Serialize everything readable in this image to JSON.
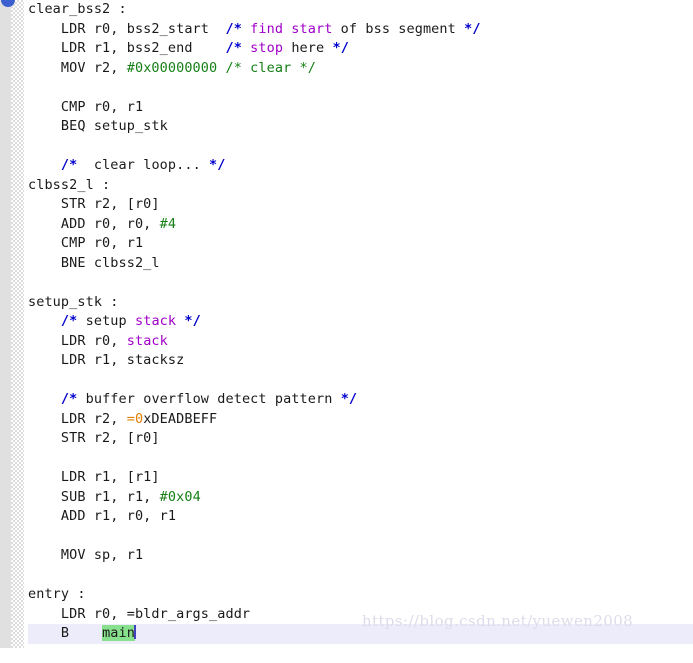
{
  "editor": {
    "title": "assembly-source-view",
    "language": "arm-assembly",
    "colors": {
      "background": "#ffffff",
      "gutter": "#e0e0e0",
      "current_line": "#ececfa",
      "selection": "#87e08c",
      "caret": "#4040c0",
      "default_text": "#1a1a1a",
      "comment_delimiter": "#0000cc",
      "comment_keyword": "#a000c8",
      "comment_green": "#178017",
      "number": "#178017",
      "orange_literal": "#e08000",
      "purple_symbol": "#a000c8",
      "watermark": "#dcdcea"
    }
  },
  "watermark": {
    "text": "https://blog.csdn.net/yuewen2008"
  },
  "code": {
    "lines": [
      {
        "id": 1,
        "current": false,
        "tokens": [
          {
            "t": "clear_bss2 :",
            "c": "default"
          }
        ]
      },
      {
        "id": 2,
        "current": false,
        "tokens": [
          {
            "t": "    LDR r0, bss2_start  ",
            "c": "default"
          },
          {
            "t": "/*",
            "c": "comment-delim"
          },
          {
            "t": " ",
            "c": "default"
          },
          {
            "t": "find start",
            "c": "comment-kw"
          },
          {
            "t": " of bss segment ",
            "c": "default"
          },
          {
            "t": "*/",
            "c": "comment-delim"
          }
        ]
      },
      {
        "id": 3,
        "current": false,
        "tokens": [
          {
            "t": "    LDR r1, bss2_end    ",
            "c": "default"
          },
          {
            "t": "/*",
            "c": "comment-delim"
          },
          {
            "t": " ",
            "c": "default"
          },
          {
            "t": "stop",
            "c": "comment-kw"
          },
          {
            "t": " here ",
            "c": "default"
          },
          {
            "t": "*/",
            "c": "comment-delim"
          }
        ]
      },
      {
        "id": 4,
        "current": false,
        "tokens": [
          {
            "t": "    MOV r2, ",
            "c": "default"
          },
          {
            "t": "#0x00000000",
            "c": "number"
          },
          {
            "t": " ",
            "c": "default"
          },
          {
            "t": "/* clear */",
            "c": "comment-green"
          }
        ]
      },
      {
        "id": 5,
        "current": false,
        "tokens": [
          {
            "t": "",
            "c": "default"
          }
        ]
      },
      {
        "id": 6,
        "current": false,
        "tokens": [
          {
            "t": "    CMP r0, r1",
            "c": "default"
          }
        ]
      },
      {
        "id": 7,
        "current": false,
        "tokens": [
          {
            "t": "    BEQ setup_stk",
            "c": "default"
          }
        ]
      },
      {
        "id": 8,
        "current": false,
        "tokens": [
          {
            "t": "",
            "c": "default"
          }
        ]
      },
      {
        "id": 9,
        "current": false,
        "tokens": [
          {
            "t": "    ",
            "c": "default"
          },
          {
            "t": "/*",
            "c": "comment-delim"
          },
          {
            "t": "  clear loop... ",
            "c": "default"
          },
          {
            "t": "*/",
            "c": "comment-delim"
          }
        ]
      },
      {
        "id": 10,
        "current": false,
        "tokens": [
          {
            "t": "clbss2_l :",
            "c": "default"
          }
        ]
      },
      {
        "id": 11,
        "current": false,
        "tokens": [
          {
            "t": "    STR r2, [r0]",
            "c": "default"
          }
        ]
      },
      {
        "id": 12,
        "current": false,
        "tokens": [
          {
            "t": "    ADD r0, r0, ",
            "c": "default"
          },
          {
            "t": "#4",
            "c": "number"
          }
        ]
      },
      {
        "id": 13,
        "current": false,
        "tokens": [
          {
            "t": "    CMP r0, r1",
            "c": "default"
          }
        ]
      },
      {
        "id": 14,
        "current": false,
        "tokens": [
          {
            "t": "    BNE clbss2_l",
            "c": "default"
          }
        ]
      },
      {
        "id": 15,
        "current": false,
        "tokens": [
          {
            "t": "",
            "c": "default"
          }
        ]
      },
      {
        "id": 16,
        "current": false,
        "tokens": [
          {
            "t": "setup_stk :",
            "c": "default"
          }
        ]
      },
      {
        "id": 17,
        "current": false,
        "tokens": [
          {
            "t": "    ",
            "c": "default"
          },
          {
            "t": "/*",
            "c": "comment-delim"
          },
          {
            "t": " setup ",
            "c": "default"
          },
          {
            "t": "stack",
            "c": "comment-kw"
          },
          {
            "t": " ",
            "c": "default"
          },
          {
            "t": "*/",
            "c": "comment-delim"
          }
        ]
      },
      {
        "id": 18,
        "current": false,
        "tokens": [
          {
            "t": "    LDR r0, ",
            "c": "default"
          },
          {
            "t": "stack",
            "c": "purple"
          }
        ]
      },
      {
        "id": 19,
        "current": false,
        "tokens": [
          {
            "t": "    LDR r1, stacksz",
            "c": "default"
          }
        ]
      },
      {
        "id": 20,
        "current": false,
        "tokens": [
          {
            "t": "",
            "c": "default"
          }
        ]
      },
      {
        "id": 21,
        "current": false,
        "tokens": [
          {
            "t": "    ",
            "c": "default"
          },
          {
            "t": "/*",
            "c": "comment-delim"
          },
          {
            "t": " buffer overflow detect pattern ",
            "c": "default"
          },
          {
            "t": "*/",
            "c": "comment-delim"
          }
        ]
      },
      {
        "id": 22,
        "current": false,
        "tokens": [
          {
            "t": "    LDR r2, ",
            "c": "default"
          },
          {
            "t": "=0",
            "c": "orange"
          },
          {
            "t": "xDEADBEFF",
            "c": "default"
          }
        ]
      },
      {
        "id": 23,
        "current": false,
        "tokens": [
          {
            "t": "    STR r2, [r0]",
            "c": "default"
          }
        ]
      },
      {
        "id": 24,
        "current": false,
        "tokens": [
          {
            "t": "",
            "c": "default"
          }
        ]
      },
      {
        "id": 25,
        "current": false,
        "tokens": [
          {
            "t": "    LDR r1, [r1]",
            "c": "default"
          }
        ]
      },
      {
        "id": 26,
        "current": false,
        "tokens": [
          {
            "t": "    SUB r1, r1, ",
            "c": "default"
          },
          {
            "t": "#0x04",
            "c": "number"
          }
        ]
      },
      {
        "id": 27,
        "current": false,
        "tokens": [
          {
            "t": "    ADD r1, r0, r1",
            "c": "default"
          }
        ]
      },
      {
        "id": 28,
        "current": false,
        "tokens": [
          {
            "t": "",
            "c": "default"
          }
        ]
      },
      {
        "id": 29,
        "current": false,
        "tokens": [
          {
            "t": "    MOV sp, r1",
            "c": "default"
          }
        ]
      },
      {
        "id": 30,
        "current": false,
        "tokens": [
          {
            "t": "",
            "c": "default"
          }
        ]
      },
      {
        "id": 31,
        "current": false,
        "tokens": [
          {
            "t": "entry :",
            "c": "default"
          }
        ]
      },
      {
        "id": 32,
        "current": false,
        "tokens": [
          {
            "t": "    LDR r0, =bldr_args_addr",
            "c": "default"
          }
        ]
      },
      {
        "id": 33,
        "current": true,
        "tokens": [
          {
            "t": "    B    ",
            "c": "default"
          },
          {
            "t": "main",
            "c": "selection"
          },
          {
            "t": "",
            "c": "caret"
          }
        ]
      },
      {
        "id": 34,
        "current": false,
        "tokens": [
          {
            "t": "",
            "c": "default"
          }
        ]
      }
    ]
  }
}
